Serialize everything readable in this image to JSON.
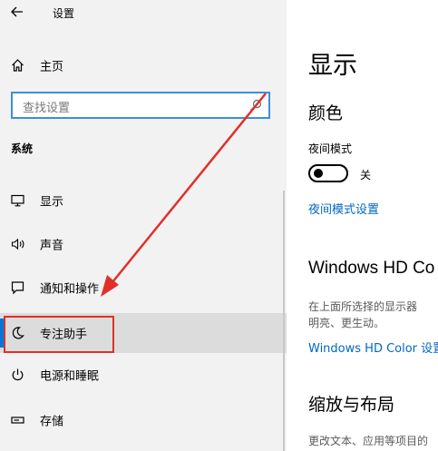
{
  "header": {
    "title": "设置"
  },
  "sidebar": {
    "home_label": "主页",
    "search_placeholder": "查找设置",
    "section_label": "系统",
    "items": [
      {
        "label": "显示",
        "icon": "monitor-icon"
      },
      {
        "label": "声音",
        "icon": "speaker-icon"
      },
      {
        "label": "通知和操作",
        "icon": "notification-icon"
      },
      {
        "label": "专注助手",
        "icon": "moon-icon",
        "selected": true
      },
      {
        "label": "电源和睡眠",
        "icon": "power-icon"
      },
      {
        "label": "存储",
        "icon": "storage-icon"
      }
    ]
  },
  "main": {
    "page_title": "显示",
    "color_heading": "颜色",
    "night_mode_label": "夜间模式",
    "night_mode_state": "关",
    "night_mode_on": false,
    "night_mode_settings_link": "夜间模式设置",
    "hd_color_heading": "Windows HD Co",
    "hd_color_desc_line1": "在上面所选择的显示器",
    "hd_color_desc_line2": "明亮、更生动。",
    "hd_color_link": "Windows HD Color 设置",
    "scale_heading": "缩放与布局",
    "scale_desc": "更改文本、应用等项目的"
  },
  "colors": {
    "accent": "#0078d7",
    "link": "#0067c0",
    "annotation_red": "#e0302a",
    "sidebar_bg": "#f2f2f2",
    "selected_bg": "#dcdcdc"
  }
}
